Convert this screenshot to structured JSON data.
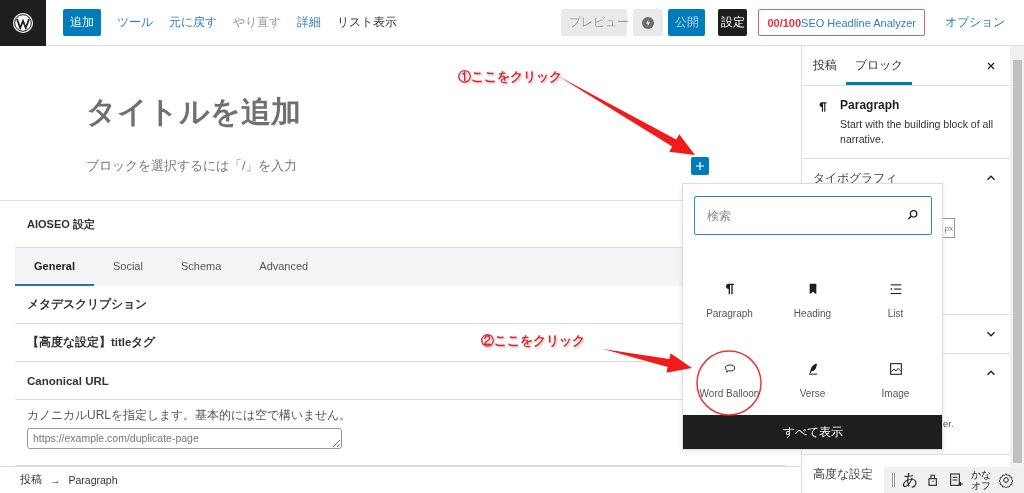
{
  "toolbar": {
    "add_button": "追加",
    "links": [
      {
        "label": "ツール",
        "kind": "link"
      },
      {
        "label": "元に戻す",
        "kind": "link"
      },
      {
        "label": "やり直す",
        "kind": "disabled"
      },
      {
        "label": "詳細",
        "kind": "link"
      },
      {
        "label": "リスト表示",
        "kind": "plain"
      }
    ],
    "preview_button": "プレビュー",
    "publish_button": "公開",
    "settings_button": "設定",
    "seo_button": {
      "score": "00/100",
      "label": "SEO Headline Analyzer"
    },
    "options_link": "オプション"
  },
  "editor": {
    "title_placeholder": "タイトルを追加",
    "block_placeholder": "ブロックを選択するには「/」を入力"
  },
  "aioseo": {
    "title": "AIOSEO 設定",
    "tabs": [
      {
        "label": "General",
        "selected": true
      },
      {
        "label": "Social",
        "selected": false
      },
      {
        "label": "Schema",
        "selected": false
      },
      {
        "label": "Advanced",
        "selected": false
      }
    ],
    "rows": [
      "メタデスクリプション",
      "【高度な設定】titleタグ",
      "Canonical URL"
    ],
    "canonical_help": "カノニカルURLを指定します。基本的には空で構いません。",
    "canonical_placeholder": "https://example.com/duplicate-page"
  },
  "breadcrumb": [
    "投稿",
    "Paragraph"
  ],
  "breadcrumb_separator": "→",
  "sidebar": {
    "tabs": [
      {
        "label": "投稿",
        "selected": false
      },
      {
        "label": "ブロック",
        "selected": true
      }
    ],
    "block": {
      "kind": "paragraph",
      "name": "Paragraph",
      "description": "Start with the building block of all narrative."
    },
    "panels": [
      {
        "title": "タイポグラフィ",
        "expanded": true,
        "unit": "px"
      },
      {
        "expanded": false
      },
      {
        "expanded": true,
        "text": "er."
      },
      {
        "title": "高度な設定"
      }
    ]
  },
  "inserter": {
    "search_placeholder": "検索",
    "blocks": [
      {
        "kind": "paragraph",
        "label": "Paragraph"
      },
      {
        "kind": "heading",
        "label": "Heading"
      },
      {
        "kind": "list",
        "label": "List"
      },
      {
        "kind": "balloon",
        "label": "Word Balloon"
      },
      {
        "kind": "verse",
        "label": "Verse"
      },
      {
        "kind": "image",
        "label": "Image"
      }
    ],
    "show_all": "すべて表示"
  },
  "annotations": [
    {
      "label": "①ここをクリック"
    },
    {
      "label": "②ここをクリック"
    }
  ],
  "ime": {
    "mode": "あ",
    "kana": [
      "かな",
      "オフ"
    ]
  }
}
